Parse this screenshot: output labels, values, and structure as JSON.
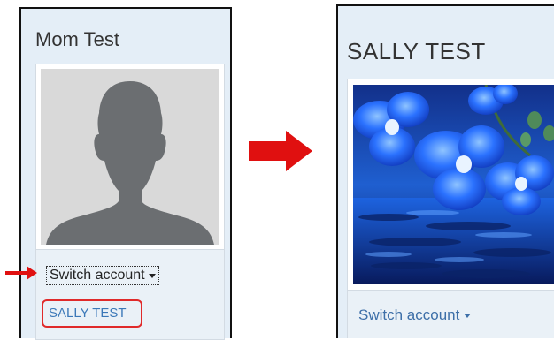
{
  "left_panel": {
    "account_name": "Mom Test",
    "switch_account_label": "Switch account",
    "menu_account_label": "SALLY TEST"
  },
  "right_panel": {
    "account_name": "SALLY TEST",
    "switch_account_label": "Switch account"
  },
  "icons": {
    "avatar": "default-person-silhouette-icon",
    "pointer_arrow": "red-arrow-right-icon",
    "transition_arrow": "red-arrow-right-icon",
    "dropdown": "caret-down-icon"
  },
  "colors": {
    "panel_bg": "#e4eef7",
    "highlight": "#e02a2a",
    "link": "#3b78b8",
    "arrow": "#e01010"
  }
}
